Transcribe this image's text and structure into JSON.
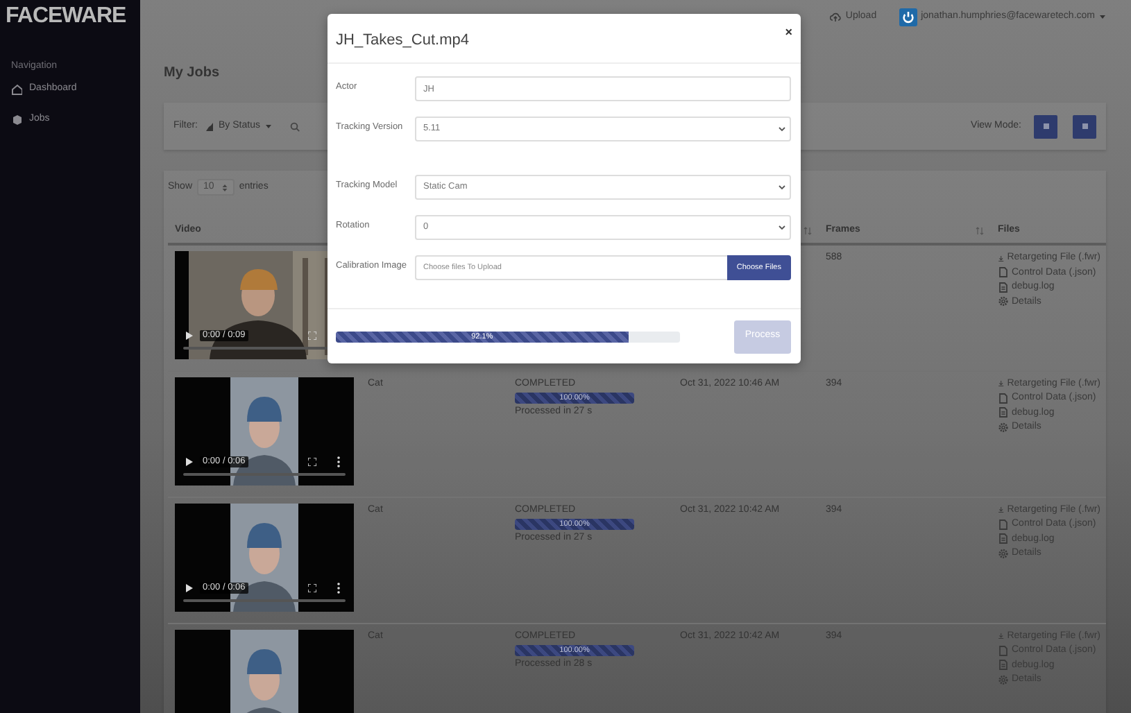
{
  "brand": {
    "logo": "FACEWARE"
  },
  "sidebar": {
    "heading": "Navigation",
    "items": [
      {
        "kind": "home",
        "label": "Dashboard"
      },
      {
        "kind": "jobs",
        "label": "Jobs"
      }
    ]
  },
  "topbar": {
    "upload": "Upload",
    "user": "jonathan.humphries@facewaretech.com"
  },
  "page_title": "My Jobs",
  "filter_bar": {
    "filter_label": "Filter:",
    "status_filter": "By Status",
    "view_mode_label": "View Mode:"
  },
  "table": {
    "show_label": "Show",
    "page_size": "10",
    "entries_label": "entries",
    "columns": [
      {
        "label": "Video"
      },
      {},
      {},
      {
        "sortable": true
      },
      {
        "label": "Frames",
        "sortable": true
      },
      {
        "label": "Files"
      }
    ],
    "rows": [
      {
        "video_time": "0:00 / 0:09",
        "frames": "588",
        "files": [
          {
            "kind": "download",
            "label": "Retargeting File (.fwr)"
          },
          {
            "kind": "file",
            "label": "Control Data (.json)"
          },
          {
            "kind": "log",
            "label": "debug.log"
          },
          {
            "kind": "details",
            "label": "Details"
          }
        ]
      },
      {
        "video_time": "0:00 / 0:06",
        "actor": "Cat",
        "status": "COMPLETED",
        "progress": {
          "level": 1,
          "label": "100.00%"
        },
        "duration": "Processed in 27 s",
        "date": "Oct 31, 2022 10:46 AM",
        "frames": "394",
        "files": [
          {
            "kind": "download",
            "label": "Retargeting File (.fwr)"
          },
          {
            "kind": "file",
            "label": "Control Data (.json)"
          },
          {
            "kind": "log",
            "label": "debug.log"
          },
          {
            "kind": "details",
            "label": "Details"
          }
        ]
      },
      {
        "video_time": "0:00 / 0:06",
        "actor": "Cat",
        "status": "COMPLETED",
        "progress": {
          "level": 1,
          "label": "100.00%"
        },
        "duration": "Processed in 27 s",
        "date": "Oct 31, 2022 10:42 AM",
        "frames": "394",
        "files": [
          {
            "kind": "download",
            "label": "Retargeting File (.fwr)"
          },
          {
            "kind": "file",
            "label": "Control Data (.json)"
          },
          {
            "kind": "log",
            "label": "debug.log"
          },
          {
            "kind": "details",
            "label": "Details"
          }
        ]
      },
      {
        "actor": "Cat",
        "status": "COMPLETED",
        "progress": {
          "level": 1,
          "label": "100.00%"
        },
        "duration": "Processed in 28 s",
        "date": "Oct 31, 2022 10:42 AM",
        "frames": "394",
        "files": [
          {
            "kind": "download",
            "label": "Retargeting File (.fwr)"
          },
          {
            "kind": "file",
            "label": "Control Data (.json)"
          },
          {
            "kind": "log",
            "label": "debug.log"
          },
          {
            "kind": "details",
            "label": "Details"
          }
        ]
      }
    ]
  },
  "modal": {
    "title": "JH_Takes_Cut.mp4",
    "close": "×",
    "fields": [
      {
        "kind": "text",
        "label": "Actor",
        "value": "JH"
      },
      {
        "kind": "select",
        "label": "Tracking Version",
        "value": "5.11"
      },
      {
        "kind": "select",
        "label": "Tracking Model",
        "value": "Static Cam"
      },
      {
        "kind": "select",
        "label": "Rotation",
        "value": "0"
      },
      {
        "kind": "file",
        "label": "Calibration Image",
        "placeholder": "Choose files To Upload",
        "button": "Choose Files"
      }
    ],
    "progress": {
      "level": 0.85,
      "label": "92.1%"
    },
    "process_button": {
      "label": "Process",
      "disabled": true
    }
  }
}
